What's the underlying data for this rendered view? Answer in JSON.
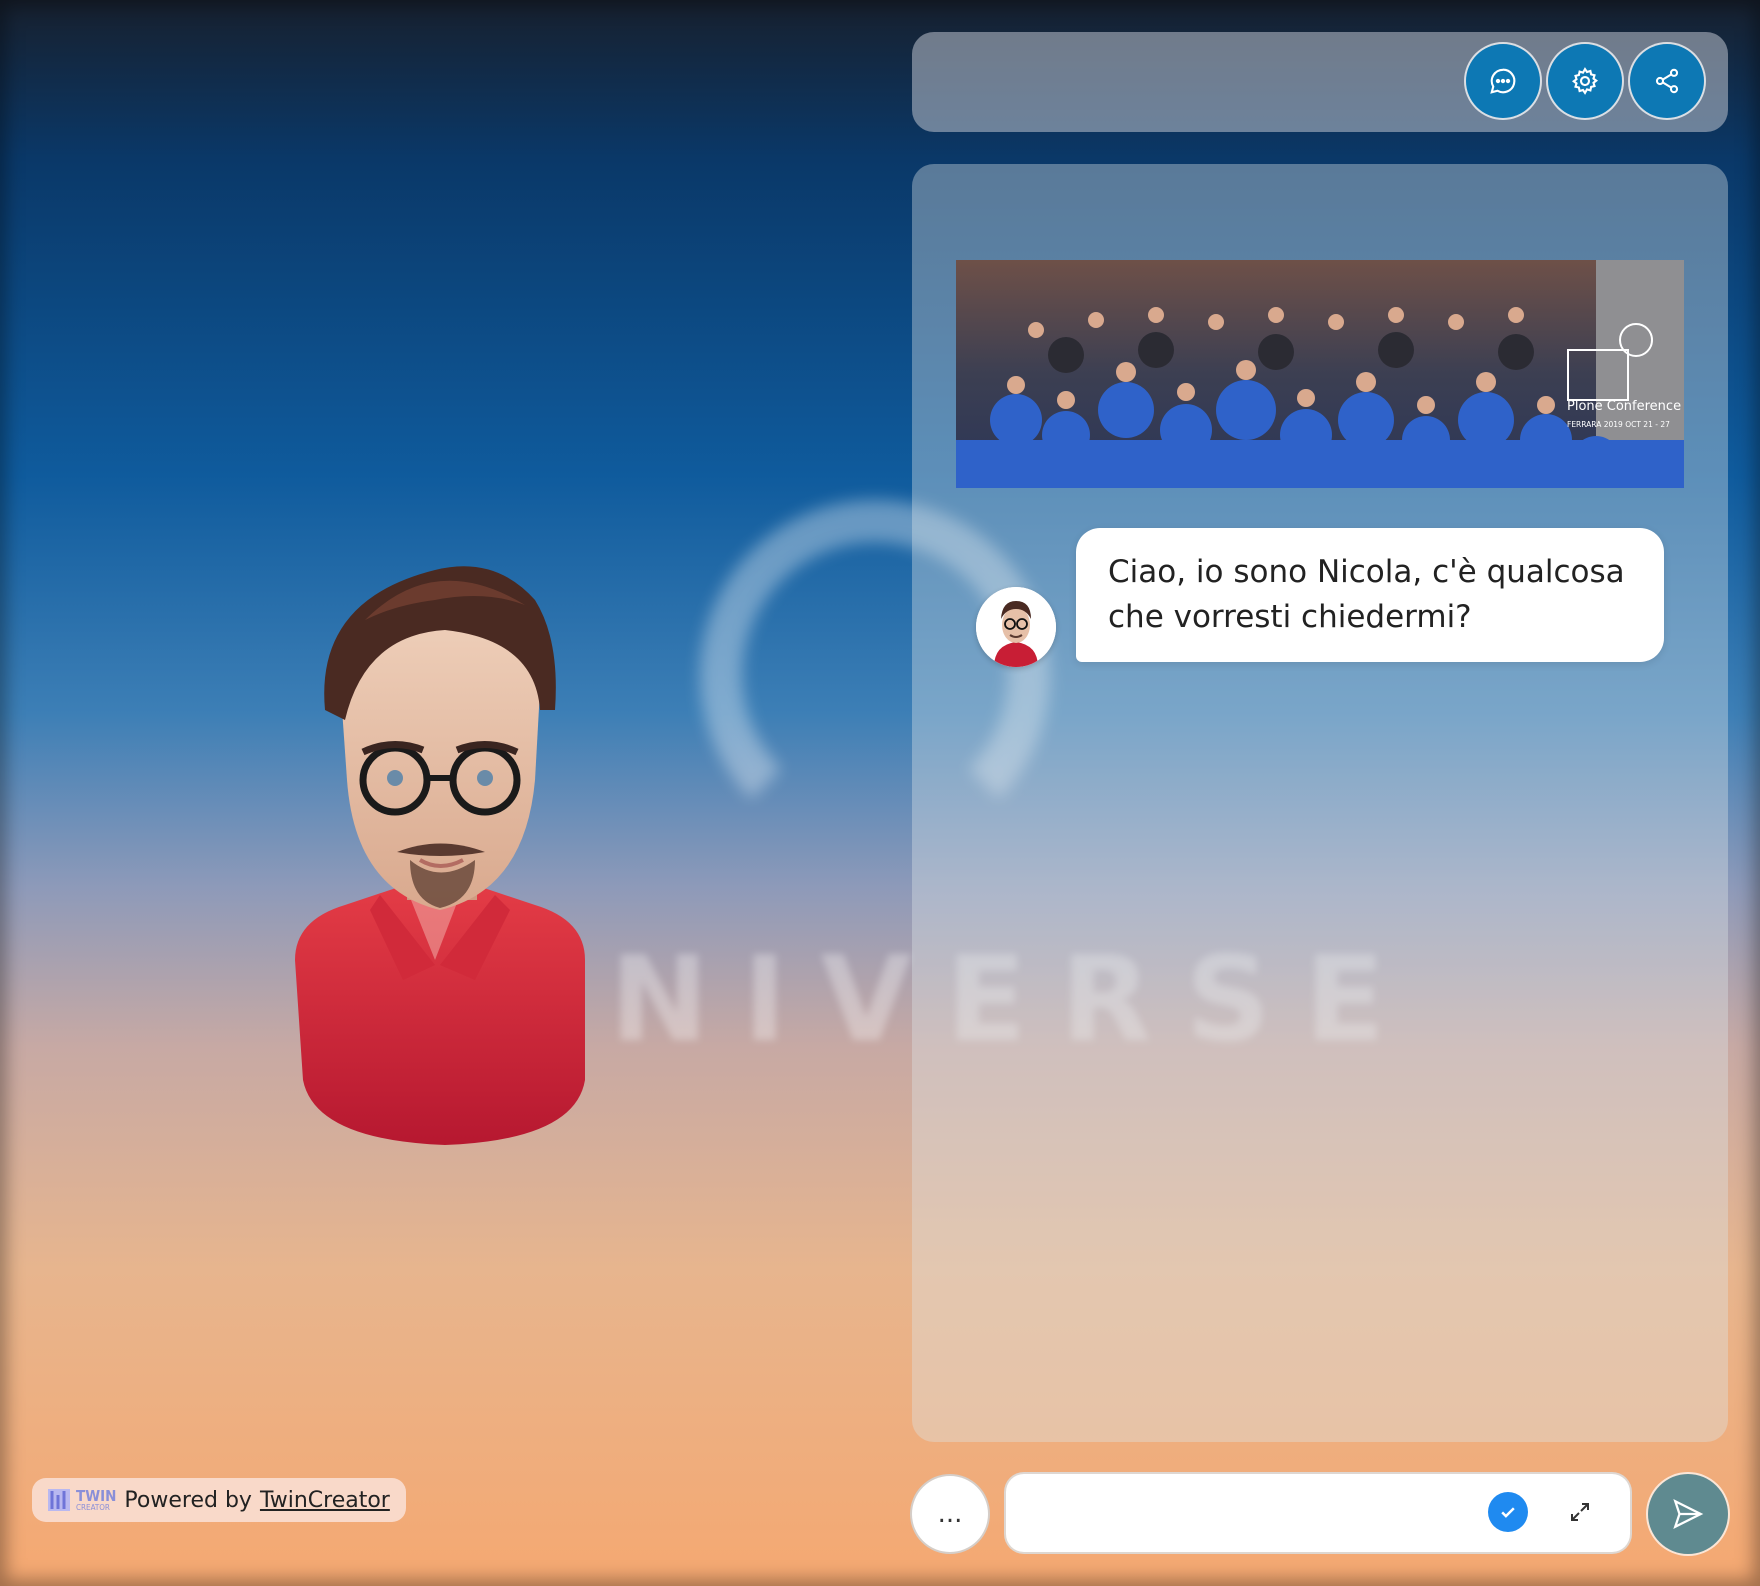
{
  "toolbar": {
    "chat_icon": "chat-bubble-icon",
    "settings_icon": "gear-icon",
    "share_icon": "share-icon"
  },
  "chat": {
    "banner_caption": "Plone Conference",
    "banner_subcaption": "FERRARA 2019 OCT 21 - 27",
    "messages": [
      {
        "sender": "bot",
        "text": "Ciao, io sono Nicola, c'è qualcosa che vorresti chiedermi?"
      }
    ]
  },
  "composer": {
    "dots_label": "...",
    "input_value": "",
    "input_placeholder": ""
  },
  "footer": {
    "logo_line1": "TWIN",
    "logo_line2": "CREATOR",
    "powered_prefix": "Powered by",
    "powered_link": "TwinCreator"
  },
  "background": {
    "watermark_text": "NIVERSE"
  },
  "colors": {
    "toolbar_button": "#0d78b4",
    "send_button": "#5f8a90",
    "check": "#1f8af0"
  }
}
